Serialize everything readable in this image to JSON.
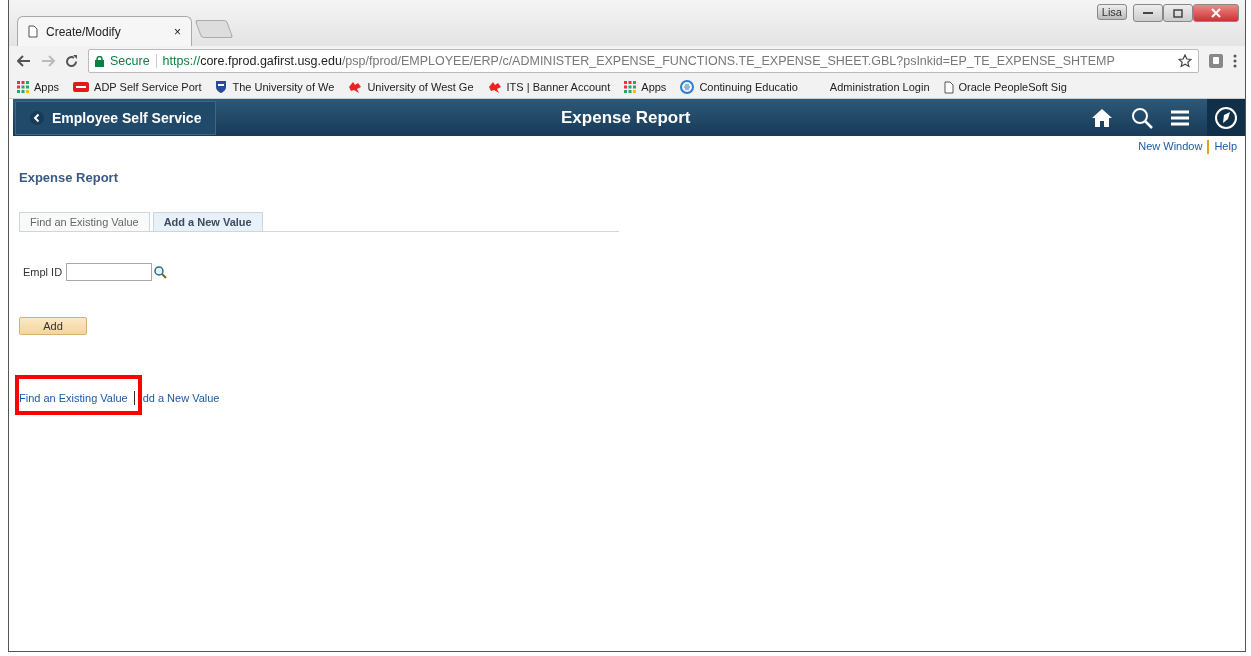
{
  "browser": {
    "user_badge": "Lisa",
    "tab": {
      "title": "Create/Modify",
      "close": "×"
    },
    "address": {
      "secure_label": "Secure",
      "scheme": "https://",
      "host": "core.fprod.gafirst.usg.edu",
      "path": "/psp/fprod/EMPLOYEE/ERP/c/ADMINISTER_EXPENSE_FUNCTIONS.TE_EXPENSE_SHEET.GBL?psInkid=EP_TE_EXPENSE_SHTEMP"
    },
    "bookmarks": [
      {
        "kind": "apps",
        "label": "Apps"
      },
      {
        "kind": "adp",
        "label": "ADP Self Service Port"
      },
      {
        "kind": "shield",
        "label": "The University of We"
      },
      {
        "kind": "wolf",
        "label": "University of West Ge"
      },
      {
        "kind": "wolf",
        "label": "ITS | Banner Account"
      },
      {
        "kind": "apps",
        "label": "Apps"
      },
      {
        "kind": "edu",
        "label": "Continuing Educatio"
      },
      {
        "kind": "none",
        "label": "Administration Login"
      },
      {
        "kind": "page",
        "label": "Oracle PeopleSoft Sig"
      }
    ]
  },
  "navbar": {
    "back_label": "Employee Self Service",
    "title": "Expense Report"
  },
  "header_links": [
    "New Window",
    "Help"
  ],
  "page_title": "Expense Report",
  "tabs": [
    {
      "label": "Find an Existing Value",
      "selected": false
    },
    {
      "label": "Add a New Value",
      "selected": true
    }
  ],
  "field": {
    "label": "Empl ID"
  },
  "add_button": "Add",
  "bottom_links": [
    "Find an Existing Value",
    "dd a New Value"
  ]
}
